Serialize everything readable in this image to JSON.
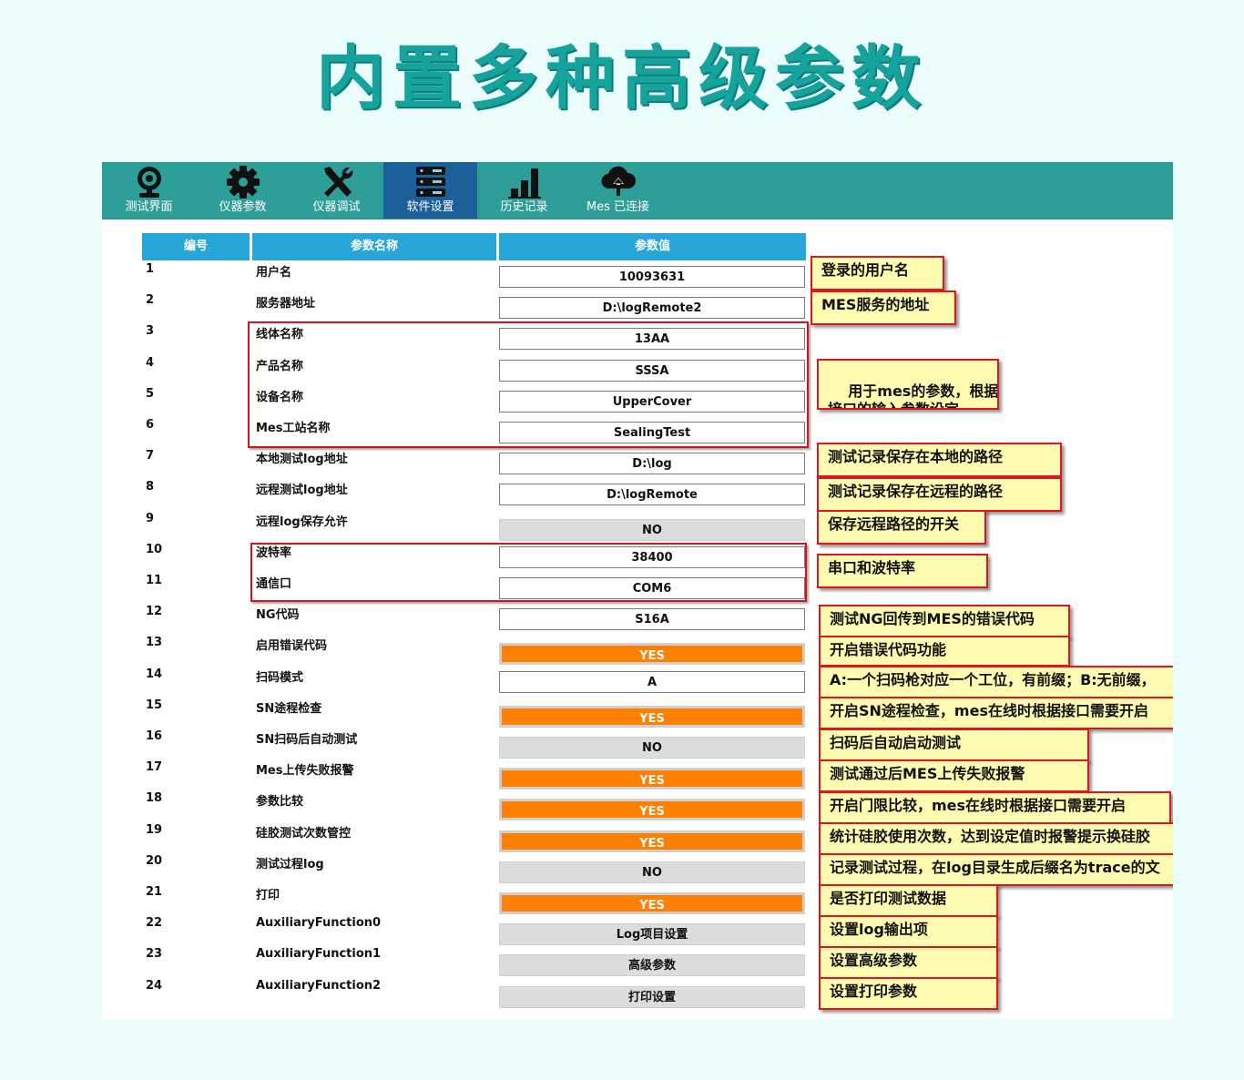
{
  "headline": "内置多种高级参数",
  "toolbar": {
    "items": [
      {
        "label": "测试界面",
        "icon": "webcam-icon",
        "active": false
      },
      {
        "label": "仪器参数",
        "icon": "gear-icon",
        "active": false
      },
      {
        "label": "仪器调试",
        "icon": "tools-icon",
        "active": false
      },
      {
        "label": "软件设置",
        "icon": "server-icon",
        "active": true
      },
      {
        "label": "历史记录",
        "icon": "bar-chart-icon",
        "active": false
      },
      {
        "label": "Mes 已连接",
        "icon": "cloud-upload-icon",
        "active": false
      }
    ]
  },
  "table": {
    "headers": [
      "编号",
      "参数名称",
      "参数值"
    ],
    "rows": [
      {
        "no": "1",
        "name": "用户名",
        "value": "10093631",
        "kind": "text"
      },
      {
        "no": "2",
        "name": "服务器地址",
        "value": "D:\\logRemote2",
        "kind": "text"
      },
      {
        "no": "3",
        "name": "线体名称",
        "value": "13AA",
        "kind": "text"
      },
      {
        "no": "4",
        "name": "产品名称",
        "value": "SSSA",
        "kind": "text"
      },
      {
        "no": "5",
        "name": "设备名称",
        "value": "UpperCover",
        "kind": "text"
      },
      {
        "no": "6",
        "name": "Mes工站名称",
        "value": "SealingTest",
        "kind": "text"
      },
      {
        "no": "7",
        "name": "本地测试log地址",
        "value": "D:\\log",
        "kind": "text"
      },
      {
        "no": "8",
        "name": "远程测试log地址",
        "value": "D:\\logRemote",
        "kind": "text"
      },
      {
        "no": "9",
        "name": "远程log保存允许",
        "value": "NO",
        "kind": "gray"
      },
      {
        "no": "10",
        "name": "波特率",
        "value": "38400",
        "kind": "text"
      },
      {
        "no": "11",
        "name": "通信口",
        "value": "COM6",
        "kind": "text"
      },
      {
        "no": "12",
        "name": "NG代码",
        "value": "S16A",
        "kind": "text"
      },
      {
        "no": "13",
        "name": "启用错误代码",
        "value": "YES",
        "kind": "orange"
      },
      {
        "no": "14",
        "name": "扫码模式",
        "value": "A",
        "kind": "text"
      },
      {
        "no": "15",
        "name": "SN途程检查",
        "value": "YES",
        "kind": "orange"
      },
      {
        "no": "16",
        "name": "SN扫码后自动测试",
        "value": "NO",
        "kind": "gray"
      },
      {
        "no": "17",
        "name": "Mes上传失败报警",
        "value": "YES",
        "kind": "orange"
      },
      {
        "no": "18",
        "name": "参数比较",
        "value": "YES",
        "kind": "orange"
      },
      {
        "no": "19",
        "name": "硅胶测试次数管控",
        "value": "YES",
        "kind": "orange"
      },
      {
        "no": "20",
        "name": "测试过程log",
        "value": "NO",
        "kind": "gray"
      },
      {
        "no": "21",
        "name": "打印",
        "value": "YES",
        "kind": "orange"
      },
      {
        "no": "22",
        "name": "AuxiliaryFunction0",
        "value": "Log项目设置",
        "kind": "gray"
      },
      {
        "no": "23",
        "name": "AuxiliaryFunction1",
        "value": "高级参数",
        "kind": "gray"
      },
      {
        "no": "24",
        "name": "AuxiliaryFunction2",
        "value": "打印设置",
        "kind": "gray"
      }
    ]
  },
  "annotations": {
    "n1": "登录的用户名",
    "n2": "MES服务的地址",
    "n3": "用于mes的参数，根据\n接口的输入参数设定",
    "n4": "测试记录保存在本地的路径",
    "n5": "测试记录保存在远程的路径",
    "n6": "保存远程路径的开关",
    "n7": "串口和波特率",
    "n8": "测试NG回传到MES的错误代码",
    "n9": "开启错误代码功能",
    "n10": "A:一个扫码枪对应一个工位，有前缀；B:无前缀，",
    "n11": "开启SN途程检查，mes在线时根据接口需要开启",
    "n12": "扫码后自动启动测试",
    "n13": "测试通过后MES上传失败报警",
    "n14": "开启门限比较，mes在线时根据接口需要开启",
    "n15": "统计硅胶使用次数，达到设定值时报警提示换硅胶",
    "n16": "记录测试过程，在log目录生成后缀名为trace的文",
    "n17": "是否打印测试数据",
    "n18": "设置log输出项",
    "n19": "设置高级参数",
    "n20": "设置打印参数"
  }
}
